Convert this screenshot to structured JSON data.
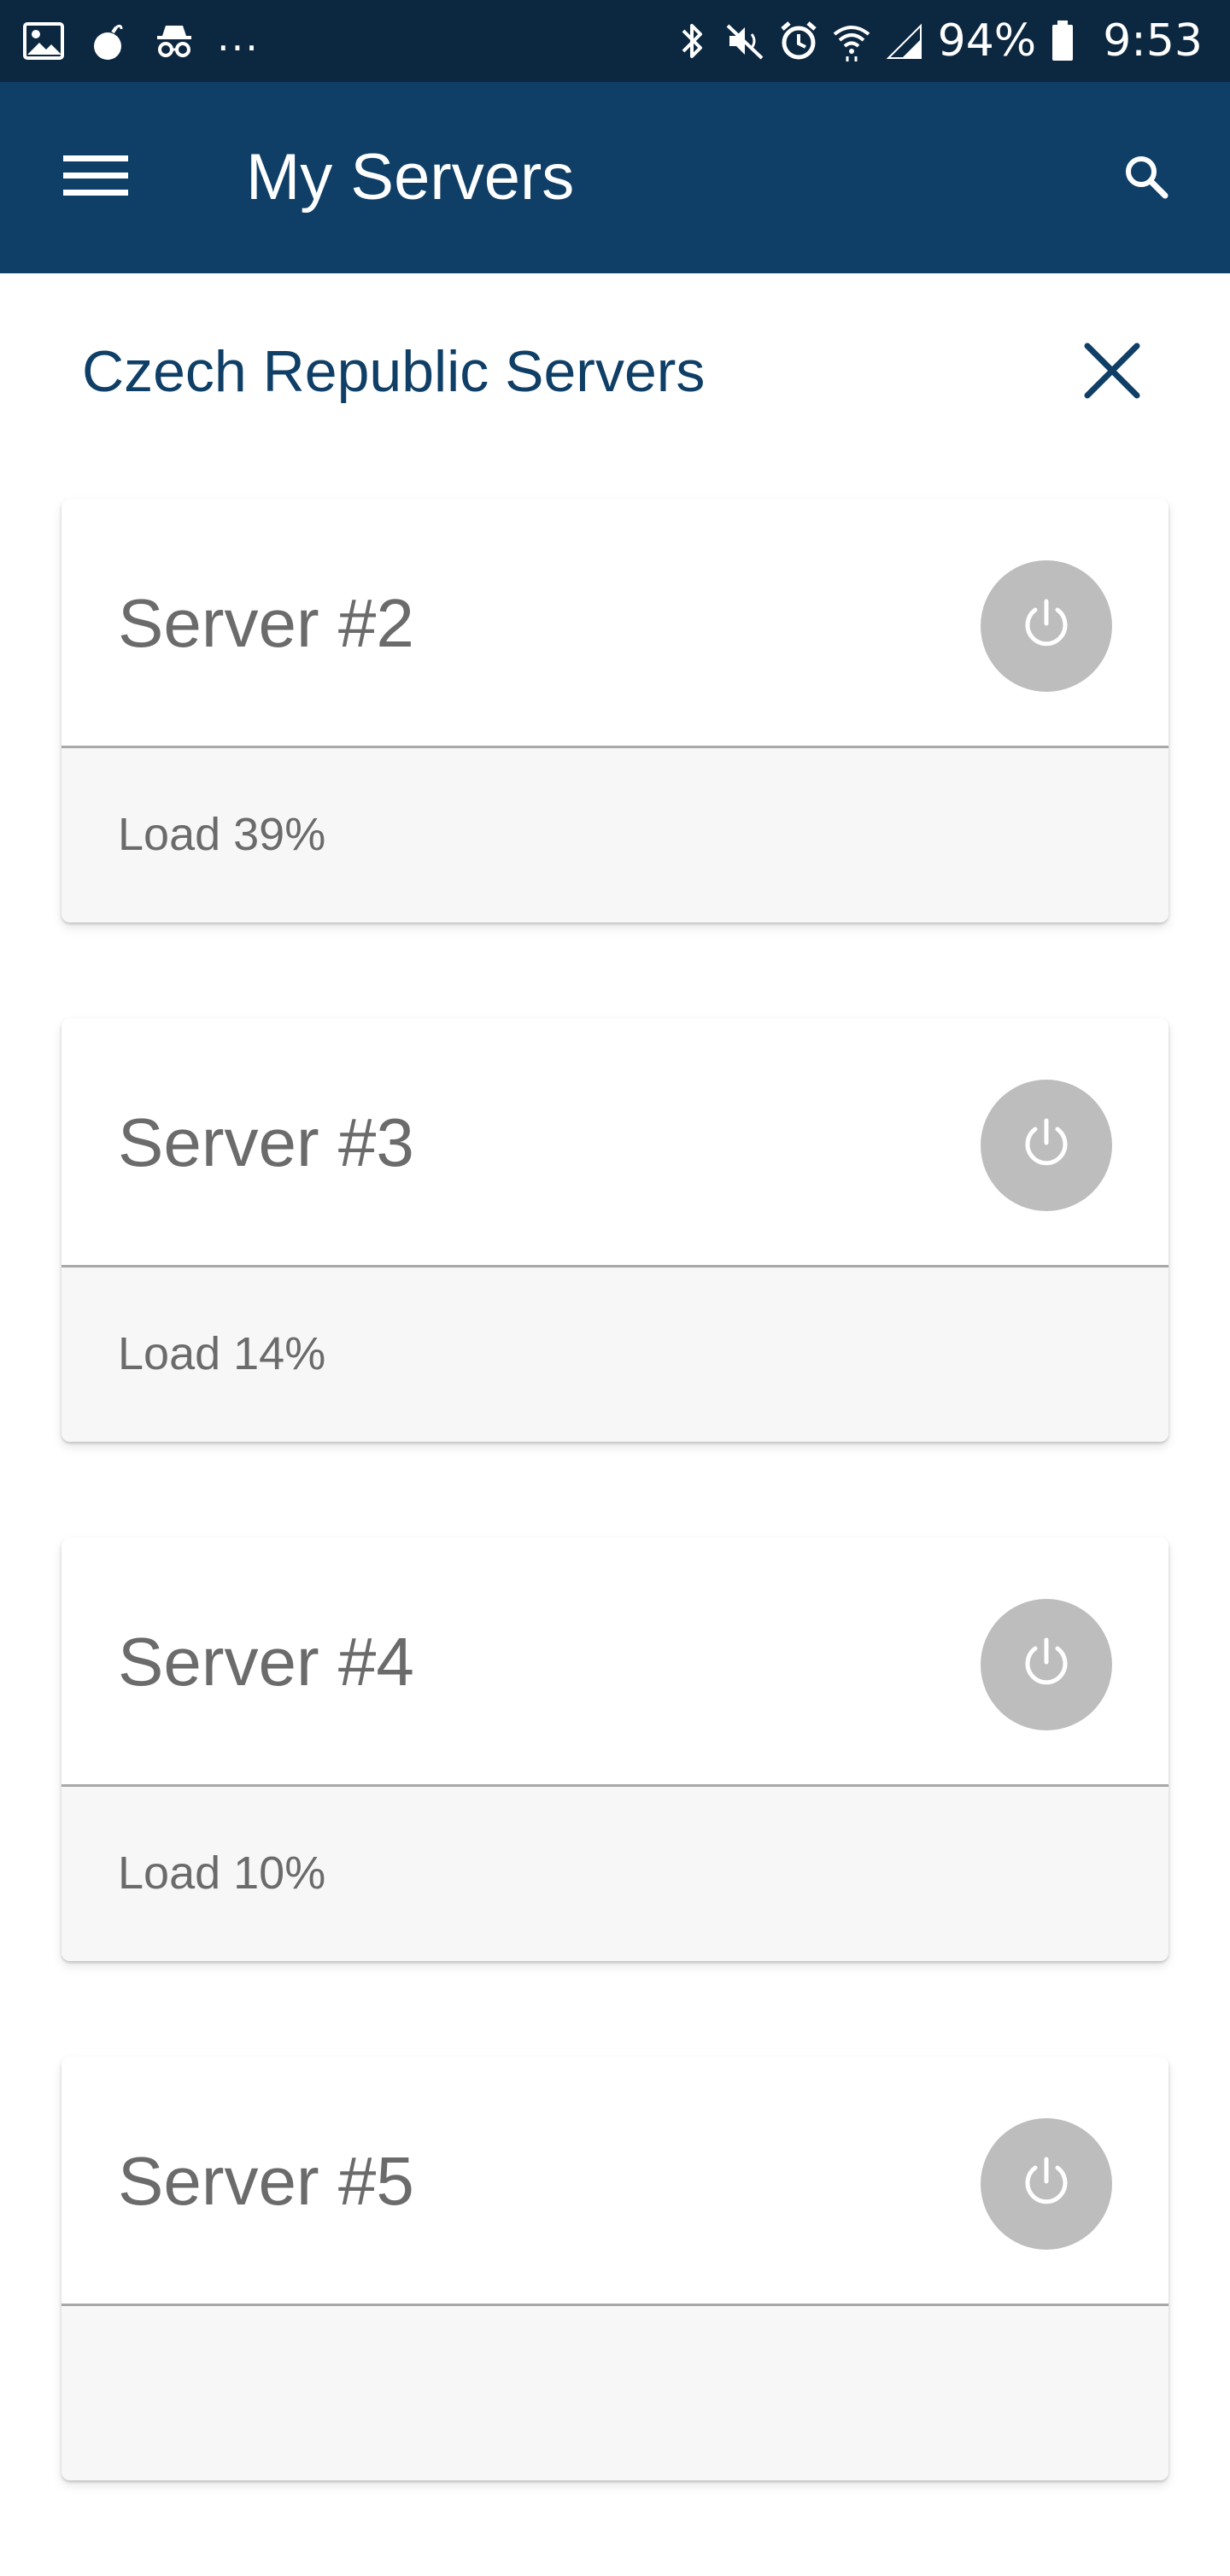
{
  "status_bar": {
    "battery_text": "94%",
    "time": "9:53",
    "left_icons": [
      "image-icon",
      "bomb-icon",
      "incognito-icon"
    ],
    "overflow_text": "...",
    "right_icons": [
      "bluetooth-icon",
      "mute-icon",
      "alarm-icon",
      "wifi-icon",
      "signal-icon",
      "battery-icon"
    ]
  },
  "app_bar": {
    "title": "My Servers",
    "menu_icon": "hamburger-menu-icon",
    "search_icon": "search-icon",
    "background_color": "#0f3f66"
  },
  "section": {
    "title": "Czech Republic Servers",
    "close_icon": "close-icon",
    "title_color": "#0f3f66"
  },
  "servers": [
    {
      "name": "Server #2",
      "load": "Load 39%"
    },
    {
      "name": "Server #3",
      "load": "Load 14%"
    },
    {
      "name": "Server #4",
      "load": "Load 10%"
    },
    {
      "name": "Server #5",
      "load": ""
    }
  ],
  "colors": {
    "status_bar": "#0c2740",
    "power_button": "#bdbdbd",
    "server_text": "#6b6b6b"
  }
}
